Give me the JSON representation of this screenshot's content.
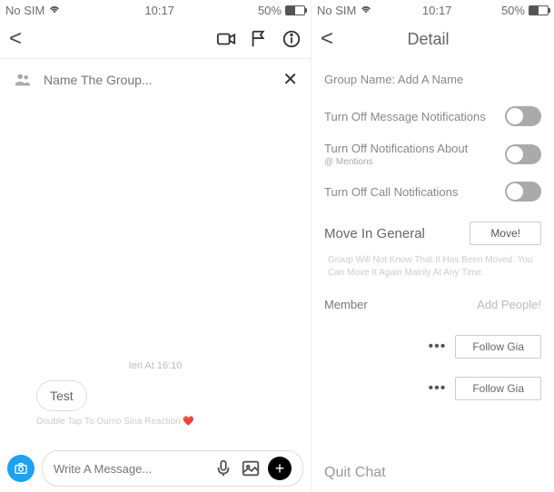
{
  "left": {
    "status": {
      "carrier": "No SIM",
      "time": "10:17",
      "battery": "50%"
    },
    "group": {
      "placeholder": "Name The Group..."
    },
    "chat": {
      "timestamp": "Ieri At 16:10",
      "message": "Test",
      "reaction_hint": "Double Tap To Oumo Sina Reaction ❤️"
    },
    "compose": {
      "placeholder": "Write A Message..."
    }
  },
  "right": {
    "status": {
      "carrier": "No SIM",
      "time": "10:17",
      "battery": "50%"
    },
    "nav": {
      "title": "Detail"
    },
    "group_name": "Group Name: Add A Name",
    "toggles": {
      "msg": "Turn Off Message Notifications",
      "mentions_label": "Turn Off Notifications About",
      "mentions_sub": "@ Mentions",
      "call": "Turn Off Call Notifications"
    },
    "move": {
      "label": "Move In General",
      "button": "Move!",
      "note": "Group Will Not Know That It Has Been Moved. You Can Move It Again Mainly At Any Time."
    },
    "member": {
      "label": "Member",
      "add": "Add People!"
    },
    "follow": "Follow Gia",
    "quit": "Quit Chat"
  }
}
